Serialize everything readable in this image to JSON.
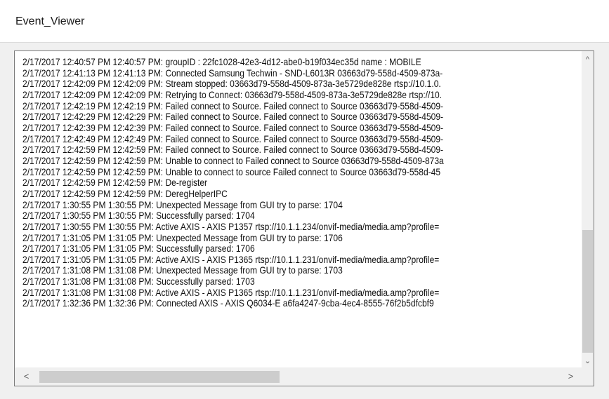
{
  "window": {
    "title": "Event_Viewer"
  },
  "log": {
    "lines": [
      "2/17/2017 12:40:57 PM 12:40:57 PM: groupID : 22fc1028-42e3-4d12-abe0-b19f034ec35d name : MOBILE",
      "2/17/2017 12:41:13 PM 12:41:13 PM: Connected Samsung Techwin - SND-L6013R 03663d79-558d-4509-873a-",
      "2/17/2017 12:42:09 PM 12:42:09 PM: Stream stopped: 03663d79-558d-4509-873a-3e5729de828e rtsp://10.1.0.",
      "2/17/2017 12:42:09 PM 12:42:09 PM: Retrying to Connect: 03663d79-558d-4509-873a-3e5729de828e rtsp://10.",
      "2/17/2017 12:42:19 PM 12:42:19 PM: Failed connect to Source. Failed connect to Source 03663d79-558d-4509-",
      "2/17/2017 12:42:29 PM 12:42:29 PM: Failed connect to Source. Failed connect to Source 03663d79-558d-4509-",
      "2/17/2017 12:42:39 PM 12:42:39 PM: Failed connect to Source. Failed connect to Source 03663d79-558d-4509-",
      "2/17/2017 12:42:49 PM 12:42:49 PM: Failed connect to Source. Failed connect to Source 03663d79-558d-4509-",
      "2/17/2017 12:42:59 PM 12:42:59 PM: Failed connect to Source. Failed connect to Source 03663d79-558d-4509-",
      "2/17/2017 12:42:59 PM 12:42:59 PM: Unable to connect to Failed connect to Source 03663d79-558d-4509-873a",
      "2/17/2017 12:42:59 PM 12:42:59 PM: Unable to connect to source Failed connect to Source 03663d79-558d-45",
      "2/17/2017 12:42:59 PM 12:42:59 PM: De-register",
      "2/17/2017 12:42:59 PM 12:42:59 PM: DeregHelperIPC",
      "2/17/2017 1:30:55 PM 1:30:55 PM: Unexpected Message from GUI try to parse: 1704",
      "2/17/2017 1:30:55 PM 1:30:55 PM: Successfully parsed: 1704",
      "2/17/2017 1:30:55 PM 1:30:55 PM: Active AXIS - AXIS P1357 rtsp://10.1.1.234/onvif-media/media.amp?profile=",
      "2/17/2017 1:31:05 PM 1:31:05 PM: Unexpected Message from GUI try to parse: 1706",
      "2/17/2017 1:31:05 PM 1:31:05 PM: Successfully parsed: 1706",
      "2/17/2017 1:31:05 PM 1:31:05 PM: Active AXIS - AXIS P1365 rtsp://10.1.1.231/onvif-media/media.amp?profile=",
      "2/17/2017 1:31:08 PM 1:31:08 PM: Unexpected Message from GUI try to parse: 1703",
      "2/17/2017 1:31:08 PM 1:31:08 PM: Successfully parsed: 1703",
      "2/17/2017 1:31:08 PM 1:31:08 PM: Active AXIS - AXIS P1365 rtsp://10.1.1.231/onvif-media/media.amp?profile=",
      "2/17/2017 1:32:36 PM 1:32:36 PM: Connected AXIS - AXIS Q6034-E a6fa4247-9cba-4ec4-8555-76f2b5dfcbf9"
    ]
  },
  "icons": {
    "scroll_up": "^",
    "scroll_down": "⌄",
    "scroll_left": "<",
    "scroll_right": ">"
  },
  "colors": {
    "window_bg": "#f0f0f0",
    "panel_bg": "#ffffff",
    "scroll_thumb": "#cdcdcd",
    "text": "#111111"
  }
}
